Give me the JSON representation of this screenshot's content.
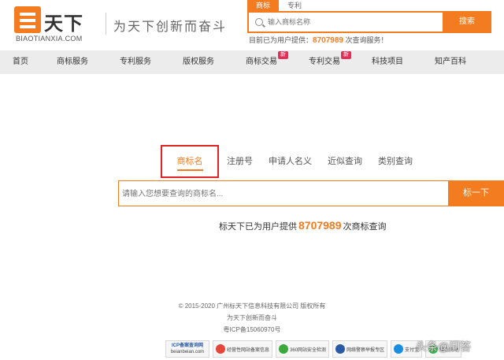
{
  "header": {
    "logo_title": "天下",
    "logo_sub": "BIAOTIANXIA.COM",
    "slogan": "为天下创新而奋斗",
    "search_tabs": [
      "商标",
      "专利"
    ],
    "search_placeholder": "输入商标名称",
    "search_button": "搜索",
    "provide_prefix": "目前已为用户提供：",
    "provide_count": "8707989",
    "provide_suffix": " 次查询服务！"
  },
  "nav": [
    {
      "label": "首页"
    },
    {
      "label": "商标服务"
    },
    {
      "label": "专利服务"
    },
    {
      "label": "版权服务"
    },
    {
      "label": "商标交易",
      "badge": "新"
    },
    {
      "label": "专利交易",
      "badge": "新"
    },
    {
      "label": "科技项目"
    },
    {
      "label": "知产百科"
    }
  ],
  "query_tabs": [
    "商标名",
    "注册号",
    "申请人名义",
    "近似查询",
    "类别查询"
  ],
  "main_search": {
    "placeholder": "请输入您想要查询的商标名...",
    "button": "标一下"
  },
  "stat": {
    "prefix": "标天下已为用户提供",
    "count": "8707989",
    "suffix": "次商标查询"
  },
  "footer": {
    "copyright": "© 2015-2020 广州标天下信息科技有限公司 版权所有",
    "slogan": "为天下创新而奋斗",
    "icp": "粤ICP备15060970号",
    "badges": [
      {
        "line1": "ICP备案查询网",
        "line2": "beianbeian.com"
      },
      {
        "label": "经营性网站备案信息"
      },
      {
        "label": "360网站安全检测"
      },
      {
        "label": "网络警察举报专区"
      },
      {
        "label": "支付宝"
      },
      {
        "label": "绿色网站"
      }
    ]
  },
  "watermark": "头条@问答",
  "colors": {
    "accent": "#f47c20",
    "highlight_box": "#e02424",
    "nav_bg": "#ececec",
    "badge": "#e62d57"
  }
}
